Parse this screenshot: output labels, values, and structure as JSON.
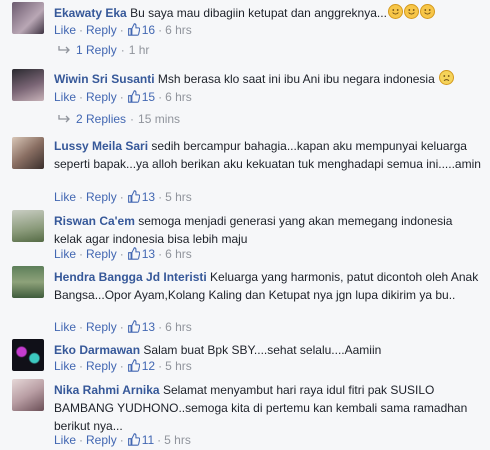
{
  "actions": {
    "like": "Like",
    "reply": "Reply",
    "sep": "·"
  },
  "comments": [
    {
      "name": "Ekawaty Eka",
      "text": "Bu saya mau dibagiin ketupat dan anggreknya...",
      "likes": "16",
      "time": "6 hrs",
      "replies": "1 Reply",
      "replies_time": "1 hr"
    },
    {
      "name": "Wiwin Sri Susanti",
      "text": "Msh berasa klo saat ini ibu Ani ibu negara indonesia",
      "likes": "15",
      "time": "6 hrs",
      "replies": "2 Replies",
      "replies_time": "15 mins"
    },
    {
      "name": "Lussy Meila Sari",
      "text": "sedih bercampur bahagia...kapan aku mempunyai keluarga seperti bapak...ya alloh berikan aku kekuatan tuk menghadapi semua ini.....amin",
      "likes": "13",
      "time": "5 hrs"
    },
    {
      "name": "Riswan Ca'em",
      "text": "semoga menjadi generasi yang akan memegang indonesia kelak agar indonesia bisa lebih maju",
      "likes": "13",
      "time": "6 hrs"
    },
    {
      "name": "Hendra Bangga Jd Interisti",
      "text": "Keluarga yang harmonis, patut dicontoh oleh Anak Bangsa...Opor Ayam,Kolang Kaling dan Ketupat nya jgn lupa dikirim ya bu..",
      "likes": "13",
      "time": "6 hrs"
    },
    {
      "name": "Eko Darmawan",
      "text": "Salam buat Bpk SBY....sehat selalu....Aamiin",
      "likes": "12",
      "time": "5 hrs"
    },
    {
      "name": "Nika Rahmi Arnika",
      "text": "Selamat menyambut hari raya idul fitri pak SUSILO BAMBANG YUDHONO..semoga kita di pertemu kan kembali sama ramadhan berikut nya...",
      "likes": "11",
      "time": "5 hrs"
    }
  ],
  "colors": {
    "link": "#365899",
    "action": "#4267b2",
    "muted": "#90949c",
    "text": "#1d2129"
  },
  "icons": {
    "like": "thumbs-up-icon",
    "reply_arrow": "reply-arrow-icon",
    "smile": "smile-emoji-icon",
    "sad": "sad-emoji-icon"
  }
}
